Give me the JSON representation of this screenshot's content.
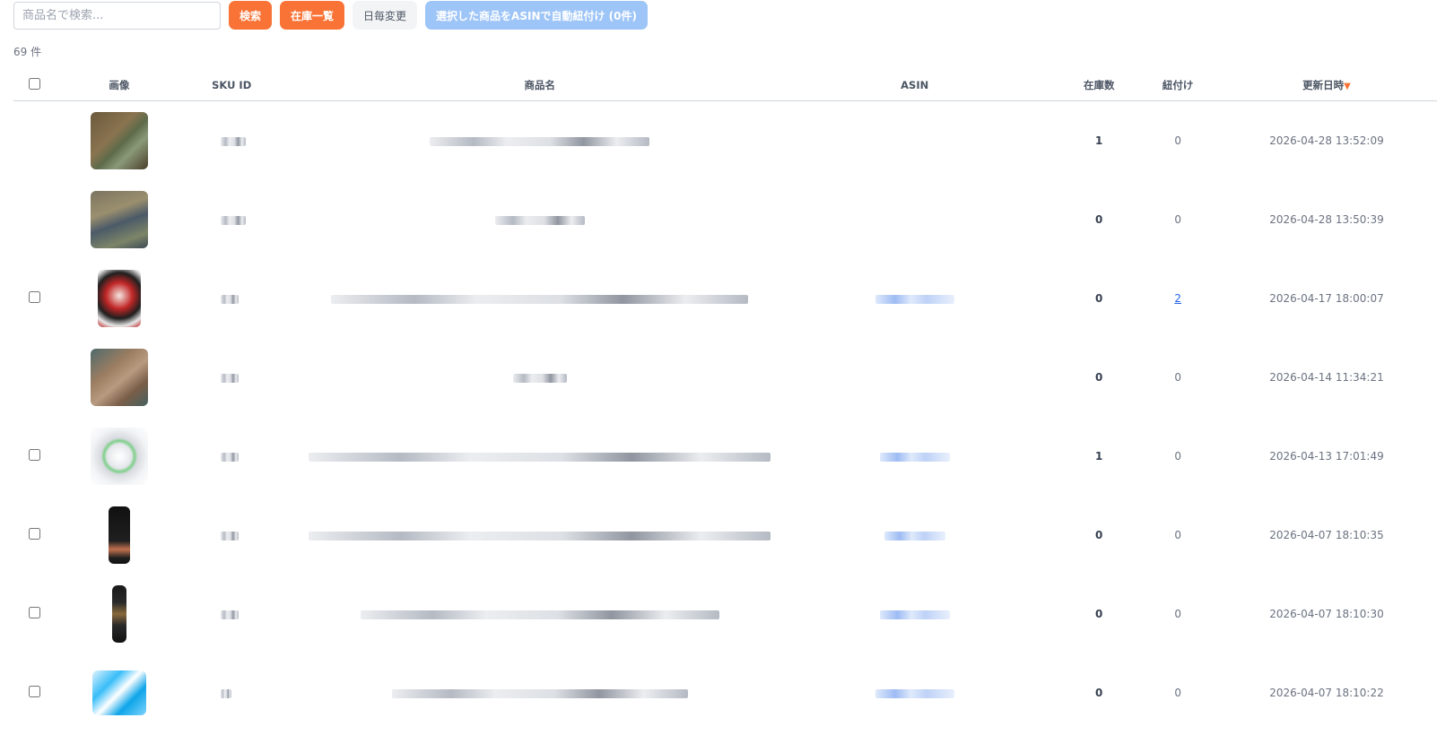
{
  "toolbar": {
    "search_placeholder": "商品名で検索...",
    "search_button": "検索",
    "inventory_button": "在庫一覧",
    "daily_change_button": "日毎変更",
    "auto_link_button": "選択した商品をASINで自動紐付け (0件)"
  },
  "count_label": "69 件",
  "table": {
    "headers": {
      "image": "画像",
      "sku": "SKU ID",
      "name": "商品名",
      "asin": "ASIN",
      "stock": "在庫数",
      "linked": "紐付け",
      "updated": "更新日時"
    },
    "sort_indicator": "▼",
    "rows": [
      {
        "checkbox": false,
        "thumb": "green-brown-package",
        "stock": "1",
        "linked": "0",
        "linked_is_link": false,
        "updated": "2026-04-28 13:52:09"
      },
      {
        "checkbox": false,
        "thumb": "green-bags",
        "stock": "0",
        "linked": "0",
        "linked_is_link": false,
        "updated": "2026-04-28 13:50:39"
      },
      {
        "checkbox": true,
        "thumb": "red-manga-book",
        "stock": "0",
        "linked": "2",
        "linked_is_link": true,
        "updated": "2026-04-17 18:00:07"
      },
      {
        "checkbox": false,
        "thumb": "brown-foil-bag",
        "stock": "0",
        "linked": "0",
        "linked_is_link": false,
        "updated": "2026-04-14 11:34:21"
      },
      {
        "checkbox": true,
        "thumb": "clear-round-device",
        "stock": "1",
        "linked": "0",
        "linked_is_link": false,
        "updated": "2026-04-13 17:01:49"
      },
      {
        "checkbox": true,
        "thumb": "black-tall-box",
        "stock": "0",
        "linked": "0",
        "linked_is_link": false,
        "updated": "2026-04-07 18:10:35"
      },
      {
        "checkbox": true,
        "thumb": "black-tube",
        "stock": "0",
        "linked": "0",
        "linked_is_link": false,
        "updated": "2026-04-07 18:10:30"
      },
      {
        "checkbox": true,
        "thumb": "blue-white-jar",
        "stock": "0",
        "linked": "0",
        "linked_is_link": false,
        "updated": "2026-04-07 18:10:22"
      }
    ]
  }
}
